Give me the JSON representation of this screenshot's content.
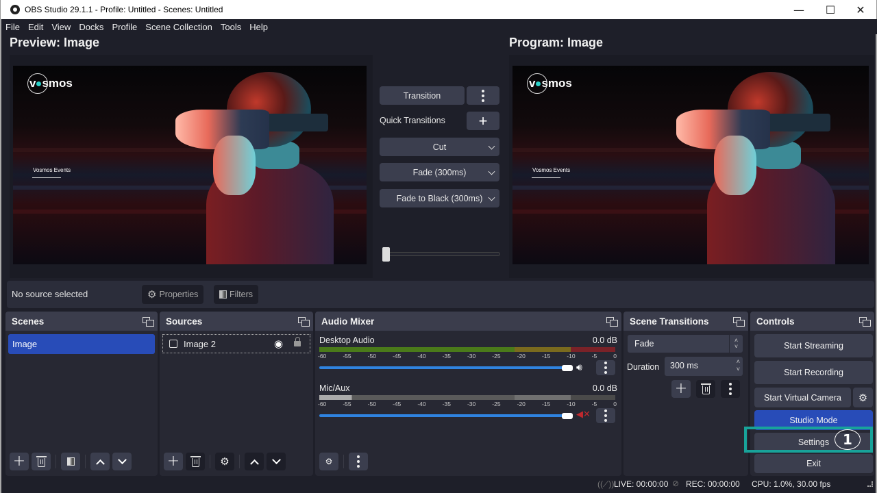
{
  "window": {
    "title": "OBS Studio 29.1.1 - Profile: Untitled - Scenes: Untitled",
    "minimize": "—",
    "maximize": "☐",
    "close": "✕"
  },
  "menu": [
    "File",
    "Edit",
    "View",
    "Docks",
    "Profile",
    "Scene Collection",
    "Tools",
    "Help"
  ],
  "preview": {
    "title": "Preview: Image",
    "brand": "v●smos",
    "event_text": "Vosmos Events"
  },
  "program": {
    "title": "Program: Image",
    "brand": "v●smos",
    "event_text": "Vosmos Events"
  },
  "transition_panel": {
    "transition_label": "Transition",
    "quick_transitions_label": "Quick Transitions",
    "quick": [
      "Cut",
      "Fade (300ms)",
      "Fade to Black (300ms)"
    ],
    "tbar_value": 0
  },
  "context_bar": {
    "status": "No source selected",
    "properties_label": "Properties",
    "filters_label": "Filters"
  },
  "scenes": {
    "title": "Scenes",
    "items": [
      {
        "label": "Image",
        "selected": true
      }
    ]
  },
  "sources": {
    "title": "Sources",
    "items": [
      {
        "label": "Image 2",
        "visible": true,
        "locked": false
      }
    ]
  },
  "audio_mixer": {
    "title": "Audio Mixer",
    "tick_labels": [
      "-60",
      "-55",
      "-50",
      "-45",
      "-40",
      "-35",
      "-30",
      "-25",
      "-20",
      "-15",
      "-10",
      "-5",
      "0"
    ],
    "channels": [
      {
        "name": "Desktop Audio",
        "db": "0.0 dB",
        "volume_percent": 100,
        "muted": false
      },
      {
        "name": "Mic/Aux",
        "db": "0.0 dB",
        "volume_percent": 100,
        "muted": true
      }
    ],
    "colors": {
      "green": "#4a7a1a",
      "yellow": "#7a6a1e",
      "red": "#7a2228",
      "slider": "#2f83e0",
      "mute": "#c0282e"
    }
  },
  "scene_transitions": {
    "title": "Scene Transitions",
    "selected": "Fade",
    "duration_label": "Duration",
    "duration_value": "300 ms"
  },
  "controls": {
    "title": "Controls",
    "start_streaming": "Start Streaming",
    "start_recording": "Start Recording",
    "start_virtual_camera": "Start Virtual Camera",
    "studio_mode": "Studio Mode",
    "settings": "Settings",
    "exit": "Exit",
    "studio_mode_color": "#284cb8"
  },
  "annotation": {
    "number": "1",
    "color": "#18a39a"
  },
  "status_bar": {
    "live": "LIVE: 00:00:00",
    "rec": "REC: 00:00:00",
    "cpu": "CPU: 1.0%, 30.00 fps"
  }
}
